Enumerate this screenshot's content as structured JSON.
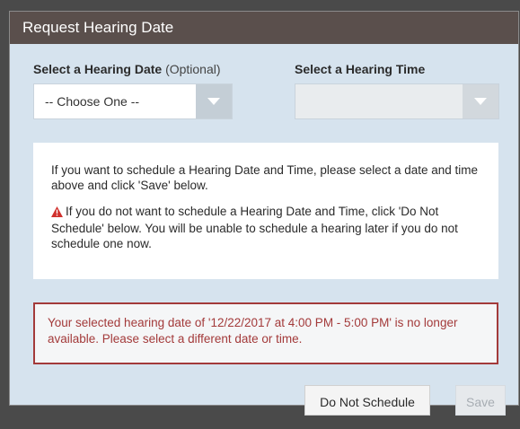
{
  "dialog": {
    "title": "Request Hearing Date"
  },
  "date_field": {
    "label": "Select a Hearing Date",
    "optional_hint": "(Optional)",
    "value": "-- Choose One --"
  },
  "time_field": {
    "label": "Select a Hearing Time",
    "value": ""
  },
  "info": {
    "paragraph1": "If you want to schedule a Hearing Date and Time, please select a date and time above and click 'Save' below.",
    "paragraph2": "If you do not want to schedule a Hearing Date and Time, click 'Do Not Schedule' below. You will be unable to schedule a hearing later if you do not schedule one now.",
    "warning_icon": "warning-triangle-icon"
  },
  "error": {
    "message": "Your selected hearing date of '12/22/2017 at 4:00 PM - 5:00 PM' is no longer available. Please select a different date or time."
  },
  "buttons": {
    "do_not_schedule": "Do Not Schedule",
    "save": "Save"
  },
  "colors": {
    "header_bg": "#5a4f4c",
    "modal_bg": "#d6e3ee",
    "error": "#a33a3a",
    "warning": "#d0312d"
  }
}
